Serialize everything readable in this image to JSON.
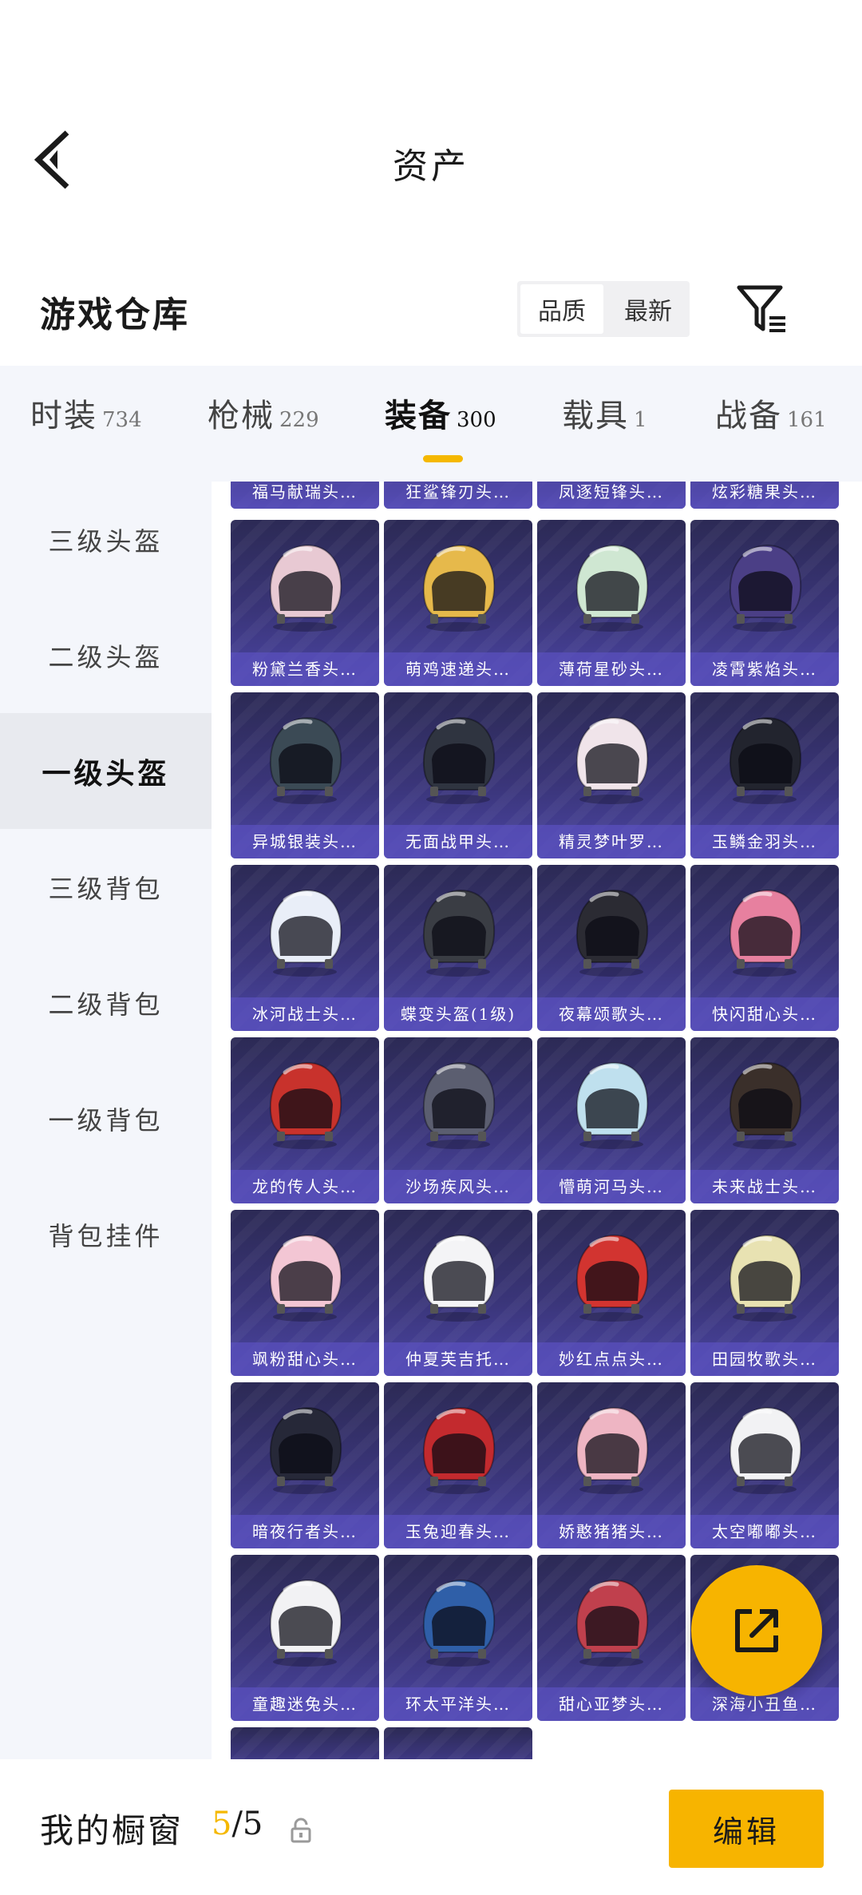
{
  "header": {
    "title": "资产",
    "section_title": "游戏仓库"
  },
  "sort": {
    "options": [
      "品质",
      "最新"
    ],
    "active": "品质"
  },
  "tabs": [
    {
      "label": "时装",
      "count": "734"
    },
    {
      "label": "枪械",
      "count": "229"
    },
    {
      "label": "装备",
      "count": "300",
      "active": true
    },
    {
      "label": "载具",
      "count": "1"
    },
    {
      "label": "战备",
      "count": "161"
    }
  ],
  "sidebar": {
    "items": [
      {
        "label": "三级头盔"
      },
      {
        "label": "二级头盔"
      },
      {
        "label": "一级头盔",
        "active": true
      },
      {
        "label": "三级背包"
      },
      {
        "label": "二级背包"
      },
      {
        "label": "一级背包"
      },
      {
        "label": "背包挂件"
      }
    ]
  },
  "items": {
    "partial_top": [
      "福马献瑞头…",
      "狂鲨锋刃头…",
      "凤逐短锋头…",
      "炫彩糖果头…"
    ],
    "rows": [
      [
        {
          "name": "粉黛兰香头…",
          "color": "#e8c9d3"
        },
        {
          "name": "萌鸡速递头…",
          "color": "#e6b94b"
        },
        {
          "name": "薄荷星砂头…",
          "color": "#cfe7d2"
        },
        {
          "name": "凌霄紫焰头…",
          "color": "#4b3f86"
        }
      ],
      [
        {
          "name": "异城银装头…",
          "color": "#3b4a55"
        },
        {
          "name": "无面战甲头…",
          "color": "#2f3440"
        },
        {
          "name": "精灵梦叶罗…",
          "color": "#f0e4ea"
        },
        {
          "name": "玉鳞金羽头…",
          "color": "#22242e"
        }
      ],
      [
        {
          "name": "冰河战士头…",
          "color": "#e9eef8"
        },
        {
          "name": "蝶变头盔(1级)",
          "color": "#3a3d44"
        },
        {
          "name": "夜幕颂歌头…",
          "color": "#2b2b33"
        },
        {
          "name": "快闪甜心头…",
          "color": "#e7809f"
        }
      ],
      [
        {
          "name": "龙的传人头…",
          "color": "#c8322c"
        },
        {
          "name": "沙场疾风头…",
          "color": "#5b5e70"
        },
        {
          "name": "懵萌河马头…",
          "color": "#bfe0ee"
        },
        {
          "name": "未来战士头…",
          "color": "#3a2f2a"
        }
      ],
      [
        {
          "name": "飒粉甜心头…",
          "color": "#f3c6d4"
        },
        {
          "name": "仲夏芙吉托…",
          "color": "#f4f4f6"
        },
        {
          "name": "妙红点点头…",
          "color": "#d23430"
        },
        {
          "name": "田园牧歌头…",
          "color": "#e8e2b2"
        }
      ],
      [
        {
          "name": "暗夜行者头…",
          "color": "#262838"
        },
        {
          "name": "玉兔迎春头…",
          "color": "#c32a2e"
        },
        {
          "name": "娇憨猪猪头…",
          "color": "#eeb5c3"
        },
        {
          "name": "太空嘟嘟头…",
          "color": "#f2f2f4"
        }
      ],
      [
        {
          "name": "童趣迷兔头…",
          "color": "#f2f2f4"
        },
        {
          "name": "环太平洋头…",
          "color": "#2f5fa8"
        },
        {
          "name": "甜心亚梦头…",
          "color": "#c0404d"
        },
        {
          "name": "深海小丑鱼…",
          "color": "#e97d2f"
        }
      ]
    ]
  },
  "showcase": {
    "label": "我的橱窗",
    "current": "5",
    "sep_total": "/5"
  },
  "edit_button": {
    "label": "编辑"
  },
  "colors": {
    "accent": "#f7b400",
    "card_bg": "#3a3579"
  }
}
